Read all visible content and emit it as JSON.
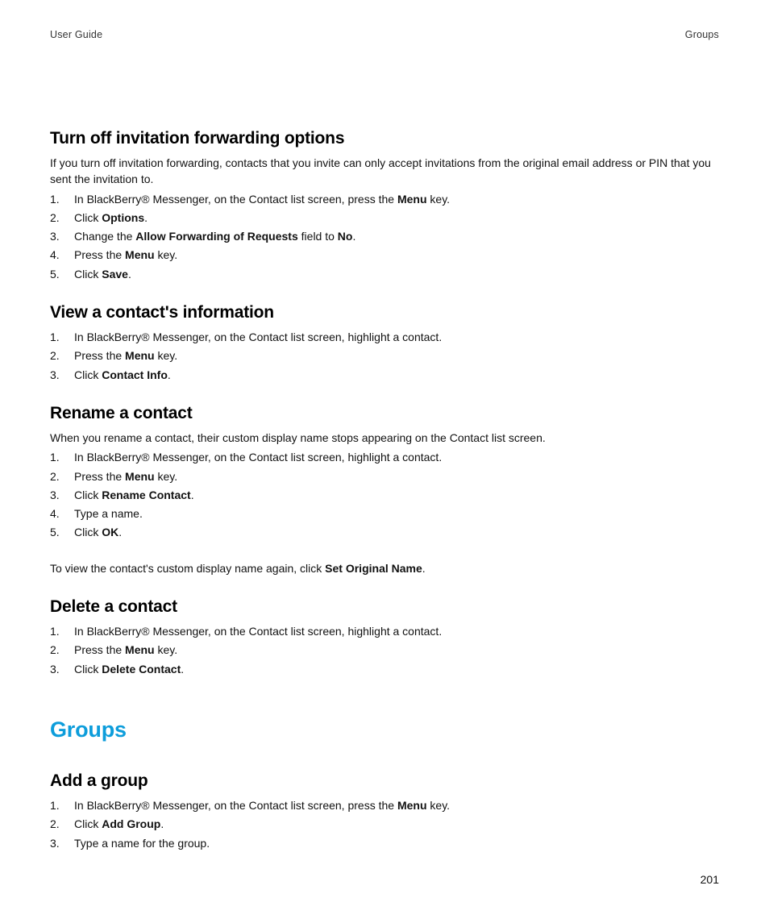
{
  "header": {
    "left": "User Guide",
    "right": "Groups"
  },
  "sections": [
    {
      "heading": "Turn off invitation forwarding options",
      "intro": "If you turn off invitation forwarding, contacts that you invite can only accept invitations from the original email address or PIN that you sent the invitation to.",
      "steps": [
        {
          "pre": "In BlackBerry® Messenger, on the Contact list screen, press the ",
          "bold": "Menu",
          "post": " key."
        },
        {
          "pre": "Click ",
          "bold": "Options",
          "post": "."
        },
        {
          "pre": "Change the ",
          "bold": "Allow Forwarding of Requests",
          "mid": " field to ",
          "bold2": "No",
          "post": "."
        },
        {
          "pre": "Press the ",
          "bold": "Menu",
          "post": " key."
        },
        {
          "pre": "Click ",
          "bold": "Save",
          "post": "."
        }
      ]
    },
    {
      "heading": "View a contact's information",
      "steps": [
        {
          "pre": "In BlackBerry® Messenger, on the Contact list screen, highlight a contact.",
          "bold": "",
          "post": ""
        },
        {
          "pre": "Press the ",
          "bold": "Menu",
          "post": " key."
        },
        {
          "pre": "Click ",
          "bold": "Contact Info",
          "post": "."
        }
      ]
    },
    {
      "heading": "Rename a contact",
      "intro": "When you rename a contact, their custom display name stops appearing on the Contact list screen.",
      "steps": [
        {
          "pre": "In BlackBerry® Messenger, on the Contact list screen, highlight a contact.",
          "bold": "",
          "post": ""
        },
        {
          "pre": "Press the ",
          "bold": "Menu",
          "post": " key."
        },
        {
          "pre": "Click ",
          "bold": "Rename Contact",
          "post": "."
        },
        {
          "pre": "Type a name.",
          "bold": "",
          "post": ""
        },
        {
          "pre": "Click ",
          "bold": "OK",
          "post": "."
        }
      ],
      "trailing": {
        "pre": "To view the contact's custom display name again, click ",
        "bold": "Set Original Name",
        "post": "."
      }
    },
    {
      "heading": "Delete a contact",
      "steps": [
        {
          "pre": "In BlackBerry® Messenger, on the Contact list screen, highlight a contact.",
          "bold": "",
          "post": ""
        },
        {
          "pre": "Press the ",
          "bold": "Menu",
          "post": " key."
        },
        {
          "pre": "Click ",
          "bold": "Delete Contact",
          "post": "."
        }
      ]
    }
  ],
  "chapter": {
    "title": "Groups",
    "sections": [
      {
        "heading": "Add a group",
        "steps": [
          {
            "pre": "In BlackBerry® Messenger, on the Contact list screen, press the ",
            "bold": "Menu",
            "post": " key."
          },
          {
            "pre": "Click ",
            "bold": "Add Group",
            "post": "."
          },
          {
            "pre": "Type a name for the group.",
            "bold": "",
            "post": ""
          }
        ]
      }
    ]
  },
  "page_number": "201"
}
